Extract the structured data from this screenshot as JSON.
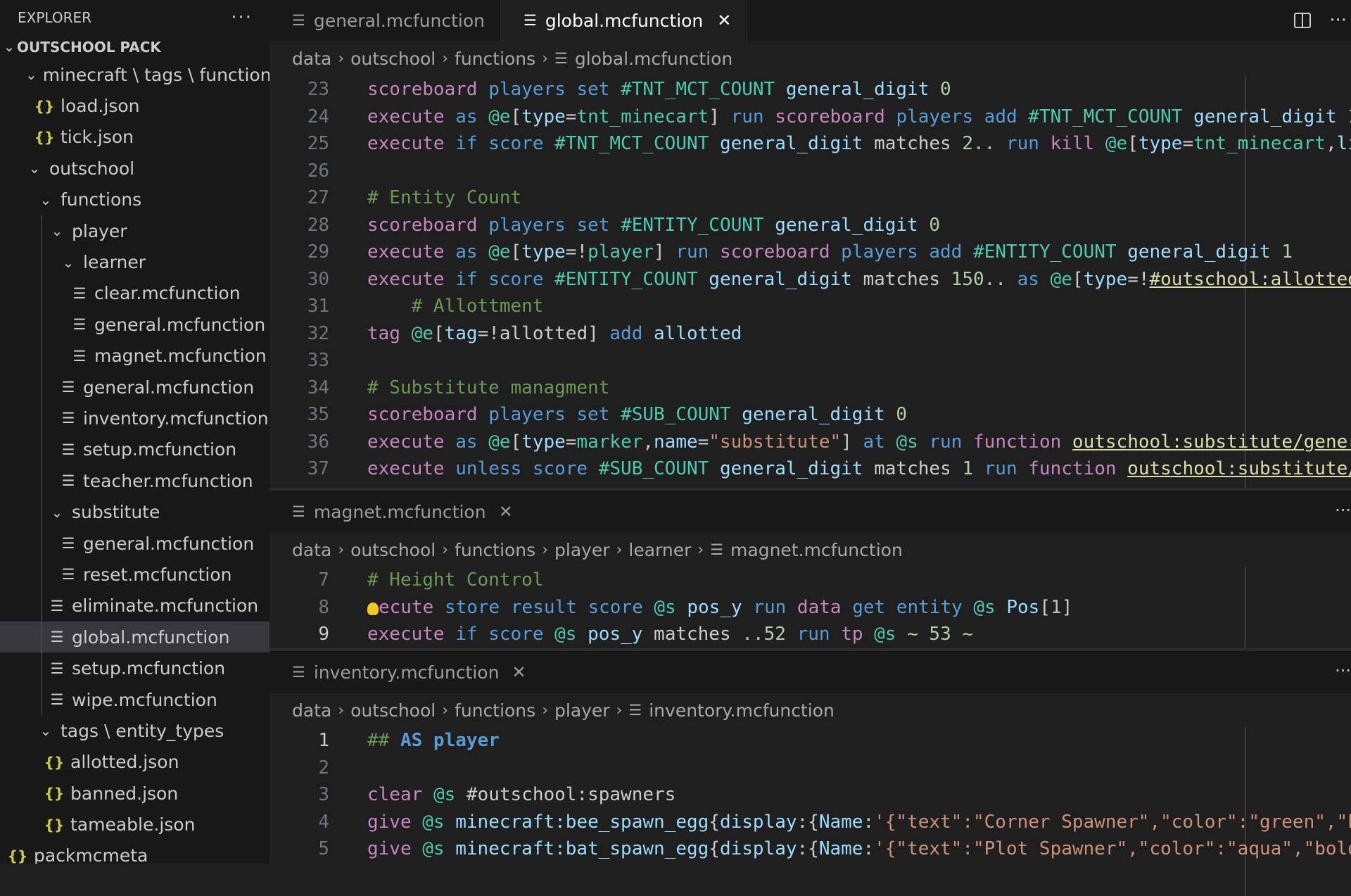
{
  "explorer": {
    "title": "EXPLORER",
    "more": "···",
    "section": "OUTSCHOOL PACK",
    "tree": {
      "mc_tags": "minecraft \\ tags \\ functions",
      "load": "load.json",
      "tick": "tick.json",
      "outschool": "outschool",
      "functions": "functions",
      "player": "player",
      "learner": "learner",
      "learner_clear": "clear.mcfunction",
      "learner_general": "general.mcfunction",
      "learner_magnet": "magnet.mcfunction",
      "player_general": "general.mcfunction",
      "player_inventory": "inventory.mcfunction",
      "player_setup": "setup.mcfunction",
      "player_teacher": "teacher.mcfunction",
      "substitute": "substitute",
      "sub_general": "general.mcfunction",
      "sub_reset": "reset.mcfunction",
      "eliminate": "eliminate.mcfunction",
      "global": "global.mcfunction",
      "setup": "setup.mcfunction",
      "wipe": "wipe.mcfunction",
      "tags_entity": "tags \\ entity_types",
      "allotted": "allotted.json",
      "banned": "banned.json",
      "tameable": "tameable.json",
      "partial": "packmcmeta"
    }
  },
  "tabs": {
    "tab1": "general.mcfunction",
    "tab2": "global.mcfunction",
    "close": "✕"
  },
  "top_pane": {
    "breadcrumb": {
      "c1": "data",
      "c2": "outschool",
      "c3": "functions",
      "c4": "global.mcfunction"
    }
  },
  "magnet_pane": {
    "tab": "magnet.mcfunction",
    "breadcrumb": {
      "c1": "data",
      "c2": "outschool",
      "c3": "functions",
      "c4": "player",
      "c5": "learner",
      "c6": "magnet.mcfunction"
    }
  },
  "inventory_pane": {
    "tab": "inventory.mcfunction",
    "breadcrumb": {
      "c1": "data",
      "c2": "outschool",
      "c3": "functions",
      "c4": "player",
      "c5": "inventory.mcfunction"
    }
  },
  "colors": {
    "keyword": "#c586c0",
    "builtin": "#569cd6",
    "type": "#4ec9b0",
    "variable": "#9cdcfe",
    "number": "#b5cea8",
    "string": "#ce9178",
    "comment": "#6a9955",
    "function": "#dcdcaa"
  },
  "icons": {
    "file": "lines-file-icon",
    "json": "braces-json-icon",
    "split": "split-editor-icon",
    "bulb": "lightbulb-icon"
  }
}
